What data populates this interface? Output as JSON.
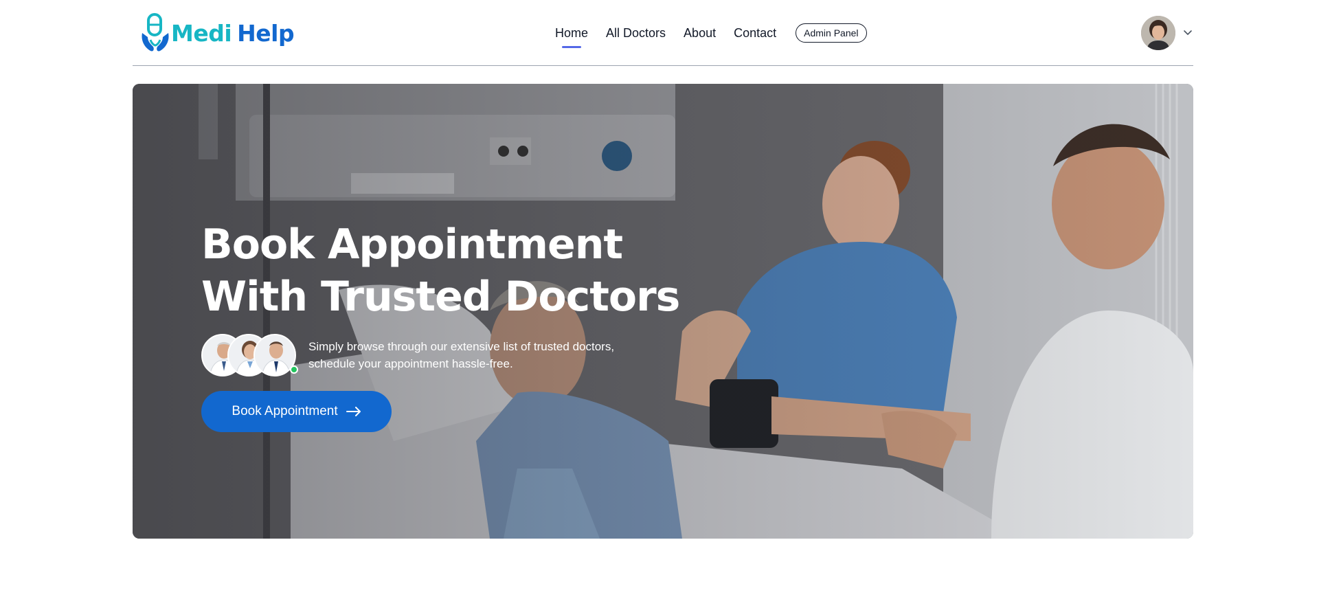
{
  "brand": {
    "name_part1": "Medi",
    "name_part2": "Help"
  },
  "nav": {
    "items": [
      {
        "label": "Home",
        "active": true
      },
      {
        "label": "All Doctors",
        "active": false
      },
      {
        "label": "About",
        "active": false
      },
      {
        "label": "Contact",
        "active": false
      }
    ],
    "admin_button": "Admin Panel"
  },
  "profile": {
    "avatar_icon": "user-avatar",
    "dropdown_icon": "chevron-down-icon"
  },
  "hero": {
    "title_line1": "Book Appointment",
    "title_line2": "With Trusted Doctors",
    "description_line1": "Simply browse through our extensive list of trusted doctors,",
    "description_line2": "schedule your appointment hassle-free.",
    "cta_label": "Book Appointment",
    "cta_icon": "arrow-right-icon"
  },
  "colors": {
    "brand_teal": "#17b6c4",
    "brand_blue": "#1268cf",
    "nav_active_underline": "#5468e7",
    "online_status": "#22c55e"
  }
}
